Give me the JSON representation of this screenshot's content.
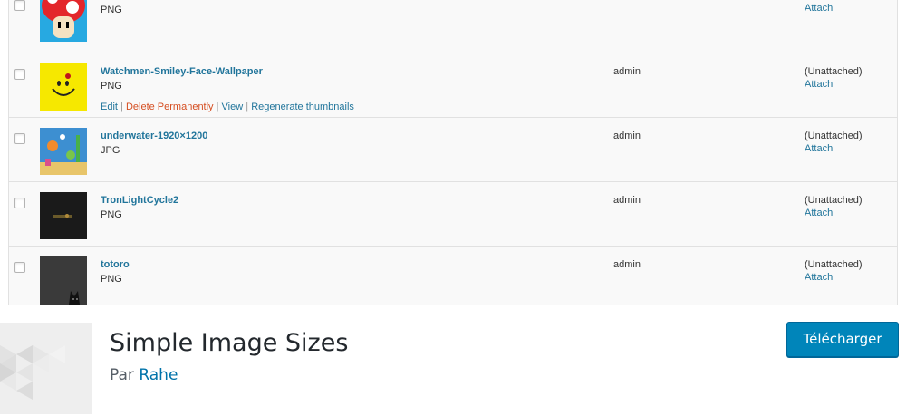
{
  "media_rows": [
    {
      "title": "",
      "type": "PNG",
      "author": "",
      "attached": "",
      "attach_link": "Attach",
      "thumb": "mushroom-icon"
    },
    {
      "title": "Watchmen-Smiley-Face-Wallpaper",
      "type": "PNG",
      "author": "admin",
      "attached": "(Unattached)",
      "attach_link": "Attach",
      "thumb": "smiley-face-icon",
      "actions": {
        "edit": "Edit",
        "delete": "Delete Permanently",
        "view": "View",
        "regenerate": "Regenerate thumbnails",
        "separator": " | "
      }
    },
    {
      "title": "underwater-1920×1200",
      "type": "JPG",
      "author": "admin",
      "attached": "(Unattached)",
      "attach_link": "Attach",
      "thumb": "underwater-image"
    },
    {
      "title": "TronLightCycle2",
      "type": "PNG",
      "author": "admin",
      "attached": "(Unattached)",
      "attach_link": "Attach",
      "thumb": "dark-lightcycle-image"
    },
    {
      "title": "totoro",
      "type": "PNG",
      "author": "admin",
      "attached": "(Unattached)",
      "attach_link": "Attach",
      "thumb": "totoro-image"
    }
  ],
  "plugin": {
    "name": "Simple Image Sizes",
    "by_label": "Par",
    "author": "Rahe",
    "download_label": "Télécharger"
  },
  "colors": {
    "link": "#21759b",
    "delete": "#d54e21",
    "button": "#0085ba"
  }
}
